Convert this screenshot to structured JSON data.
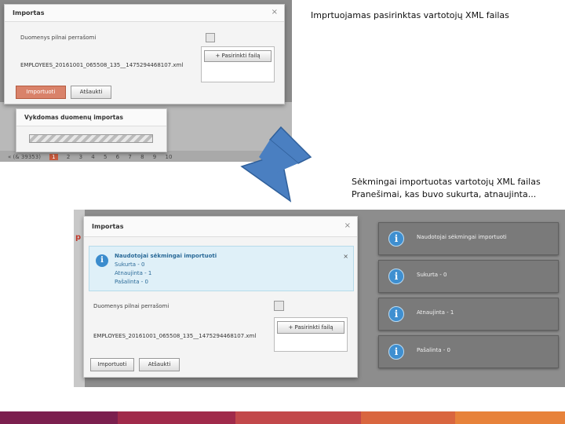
{
  "captions": {
    "top": "Imprtuojamas pasirinktas vartotojų XML failas",
    "bottom_line1": "Sėkmingai importuotas vartotojų XML failas",
    "bottom_line2": "Pranešimai, kas buvo sukurta, atnaujinta..."
  },
  "top_screenshot": {
    "dialog_title": "Importas",
    "close_glyph": "×",
    "overwrite_label": "Duomenys pilnai perrašomi",
    "pick_file_label": "+ Pasirinkti failą",
    "file_name": "EMPLOYEES_20161001_065508_135__1475294468107.xml",
    "import_button": "Importuoti",
    "cancel_button": "Atšaukti",
    "progress_title": "Vykdomas duomenų importas",
    "pager": [
      "« (& 39353)",
      "1",
      "2",
      "3",
      "4",
      "5",
      "6",
      "7",
      "8",
      "9",
      "10"
    ]
  },
  "bottom_screenshot": {
    "dialog_title": "Importas",
    "close_glyph": "×",
    "info_lines": [
      "Naudotojai sėkmingai importuoti",
      "Sukurta - 0",
      "Atnaujinta - 1",
      "Pašalinta - 0"
    ],
    "overwrite_label": "Duomenys pilnai perrašomi",
    "pick_file_label": "+ Pasirinkti failą",
    "file_name": "EMPLOYEES_20161001_065508_135__1475294468107.xml",
    "import_button": "Importuoti",
    "cancel_button": "Atšaukti",
    "notifications": [
      "Naudotojai sėkmingai importuoti",
      "Sukurta - 0",
      "Atnaujinta - 1",
      "Pašalinta - 0"
    ]
  },
  "icons": {
    "info": "info-icon",
    "arrow": "arrow-down-right-icon",
    "close": "close-icon"
  },
  "colors": {
    "accent": "#c75b3f",
    "arrow_fill": "#4a7fc1",
    "info_blue": "#3b8ccd",
    "footer": [
      "#7b1f4e",
      "#a02a4a",
      "#c2484a",
      "#d9663f",
      "#e7823a"
    ]
  }
}
